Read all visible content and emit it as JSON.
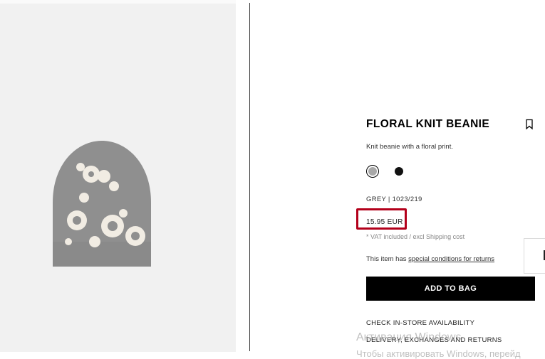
{
  "product": {
    "title": "FLORAL KNIT BEANIE",
    "description": "Knit beanie with a floral print.",
    "color_code": "GREY | 1023/219",
    "price": "15.95 EUR",
    "vat_note": "* VAT included / excl Shipping cost",
    "returns_prefix": "This item has ",
    "returns_link": "special conditions for returns",
    "add_to_bag": "ADD TO BAG",
    "links": {
      "store_availability": "CHECK IN-STORE AVAILABILITY",
      "delivery": "DELIVERY, EXCHANGES AND RETURNS"
    },
    "swatches": [
      {
        "name": "grey",
        "color": "#a8a8a8",
        "selected": true
      },
      {
        "name": "black",
        "color": "#111111",
        "selected": false
      }
    ],
    "highlight_color": "#b3001b"
  },
  "icons": {
    "bookmark": "bookmark-icon"
  },
  "watermark": {
    "line1": "Активация Windows",
    "line2": "Чтобы активировать Windows, перейд"
  }
}
